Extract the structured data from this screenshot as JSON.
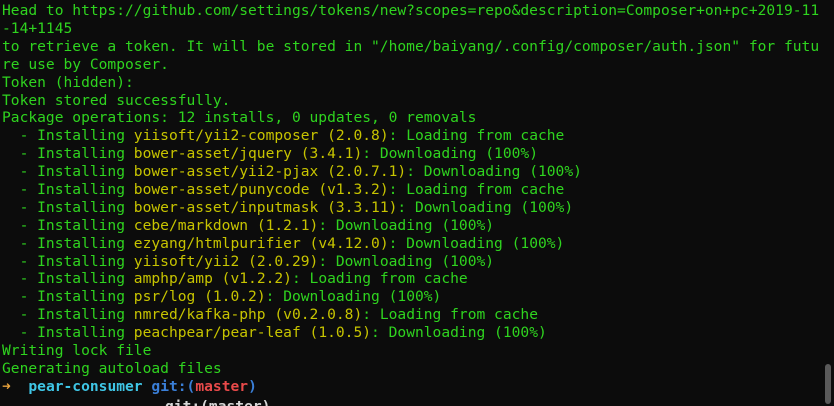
{
  "lines": [
    "Head to https://github.com/settings/tokens/new?scopes=repo&description=Composer+on+pc+2019-11-14+1145",
    "to retrieve a token. It will be stored in \"/home/baiyang/.config/composer/auth.json\" for future use by Composer.",
    "Token (hidden):",
    "Token stored successfully.",
    "Package operations: 12 installs, 0 updates, 0 removals"
  ],
  "installs": [
    {
      "prefix": "  - Installing ",
      "pkg": "yiisoft/yii2-composer",
      "ver": "(2.0.8)",
      "status": ": Loading from cache"
    },
    {
      "prefix": "  - Installing ",
      "pkg": "bower-asset/jquery",
      "ver": "(3.4.1)",
      "status": ": Downloading (100%)"
    },
    {
      "prefix": "  - Installing ",
      "pkg": "bower-asset/yii2-pjax",
      "ver": "(2.0.7.1)",
      "status": ": Downloading (100%)"
    },
    {
      "prefix": "  - Installing ",
      "pkg": "bower-asset/punycode",
      "ver": "(v1.3.2)",
      "status": ": Loading from cache"
    },
    {
      "prefix": "  - Installing ",
      "pkg": "bower-asset/inputmask",
      "ver": "(3.3.11)",
      "status": ": Downloading (100%)"
    },
    {
      "prefix": "  - Installing ",
      "pkg": "cebe/markdown",
      "ver": "(1.2.1)",
      "status": ": Downloading (100%)"
    },
    {
      "prefix": "  - Installing ",
      "pkg": "ezyang/htmlpurifier",
      "ver": "(v4.12.0)",
      "status": ": Downloading (100%)"
    },
    {
      "prefix": "  - Installing ",
      "pkg": "yiisoft/yii2",
      "ver": "(2.0.29)",
      "status": ": Downloading (100%)"
    },
    {
      "prefix": "  - Installing ",
      "pkg": "amphp/amp",
      "ver": "(v1.2.2)",
      "status": ": Loading from cache"
    },
    {
      "prefix": "  - Installing ",
      "pkg": "psr/log",
      "ver": "(1.0.2)",
      "status": ": Downloading (100%)"
    },
    {
      "prefix": "  - Installing ",
      "pkg": "nmred/kafka-php",
      "ver": "(v0.2.0.8)",
      "status": ": Loading from cache"
    },
    {
      "prefix": "  - Installing ",
      "pkg": "peachpear/pear-leaf",
      "ver": "(1.0.5)",
      "status": ": Downloading (100%)"
    }
  ],
  "tail": [
    "Writing lock file",
    "Generating autoload files"
  ],
  "prompt": {
    "arrow": "➜",
    "directory": "pear-consumer",
    "git_label": "git:(",
    "branch": "master",
    "git_close": ")"
  },
  "next_prompt_fragment": "git:(master)",
  "colors": {
    "background": "#0c0c0c",
    "green": "#2fd41f",
    "yellow": "#c7c400",
    "prompt_arrow": "#e8a23c",
    "prompt_dir": "#3fc6e6",
    "git_label": "#3a7fd8",
    "branch": "#e94a4a"
  }
}
